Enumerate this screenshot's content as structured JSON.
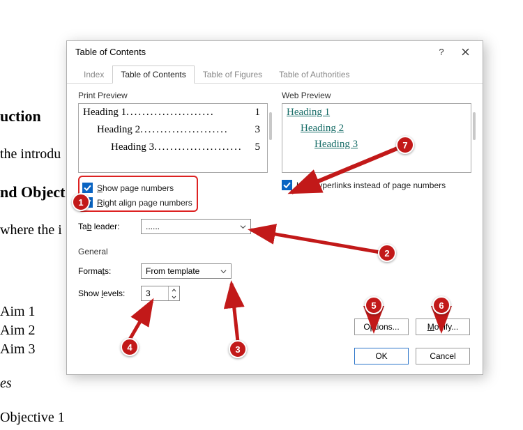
{
  "document": {
    "heading1": "uction",
    "intro": "the introdu",
    "heading2": "nd Object",
    "where": "where the i",
    "aims": [
      "Aim 1",
      "Aim 2",
      "Aim 3"
    ],
    "ital": "es",
    "obj": "Objective 1"
  },
  "dialog": {
    "title": "Table of Contents",
    "help": "?",
    "tabs": {
      "index": "Index",
      "toc": "Table of Contents",
      "tof": "Table of Figures",
      "toa": "Table of Authorities"
    },
    "print_preview": {
      "label": "Print Preview",
      "h1": "Heading 1",
      "p1": "1",
      "h2": "Heading 2",
      "p2": "3",
      "h3": "Heading 3",
      "p3": "5",
      "dots": "......................"
    },
    "web_preview": {
      "label": "Web Preview",
      "h1": "Heading 1",
      "h2": "Heading 2",
      "h3": "Heading 3"
    },
    "show_page": "Show page numbers",
    "right_align": "Right align page numbers",
    "use_hyper": "Use hyperlinks instead of page numbers",
    "tab_leader_label": "Tab leader:",
    "tab_leader_value": "......",
    "general_label": "General",
    "formats_label": "Formats:",
    "formats_value": "From template",
    "levels_label": "Show levels:",
    "levels_value": "3",
    "options": "Options...",
    "modify": "Modify...",
    "ok": "OK",
    "cancel": "Cancel"
  },
  "annot": {
    "b1": "1",
    "b2": "2",
    "b3": "3",
    "b4": "4",
    "b5": "5",
    "b6": "6",
    "b7": "7"
  }
}
